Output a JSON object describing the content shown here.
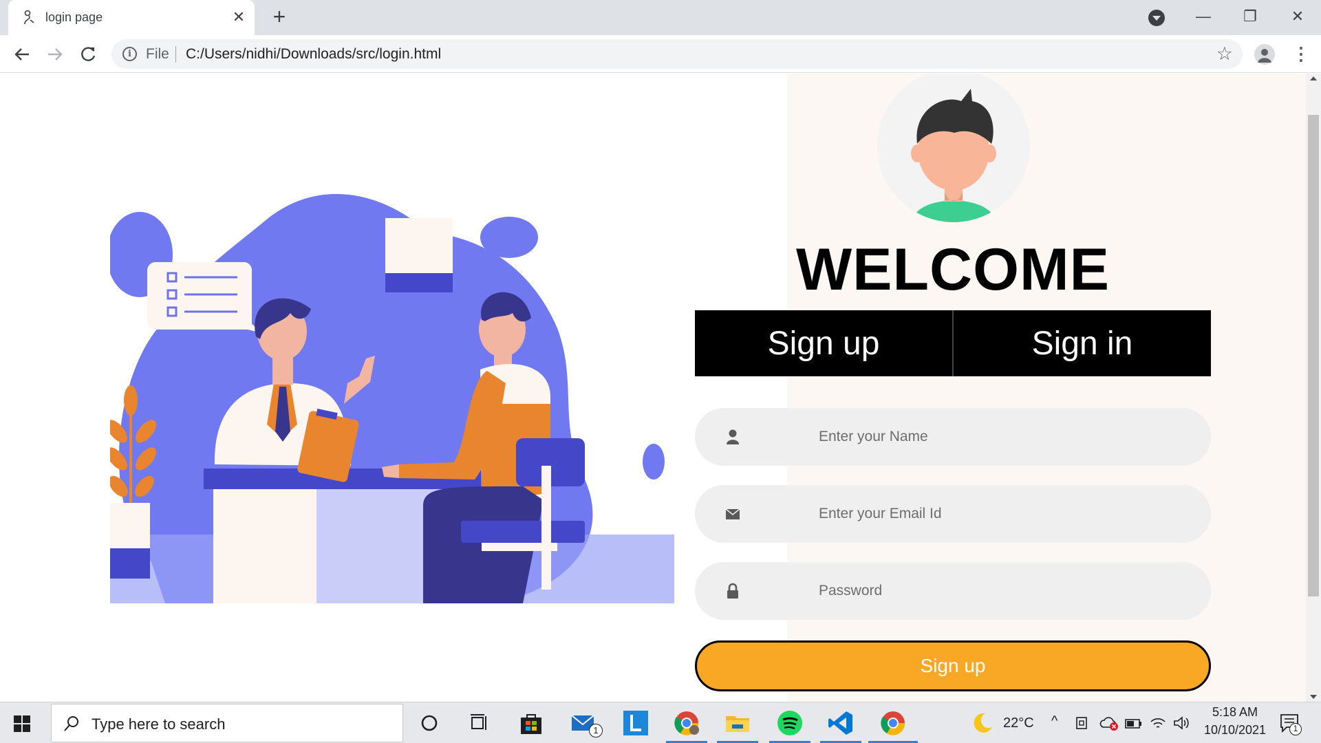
{
  "browser": {
    "tab_title": "login page",
    "tab_close": "✕",
    "new_tab": "+",
    "file_label": "File",
    "url": "C:/Users/nidhi/Downloads/src/login.html",
    "window_minimize": "—",
    "window_restore": "❐",
    "window_close": "✕"
  },
  "page": {
    "welcome": "WELCOME",
    "tabs": [
      "Sign up",
      "Sign in"
    ],
    "fields": [
      {
        "placeholder": "Enter your Name",
        "icon": "user-icon"
      },
      {
        "placeholder": "Enter your Email Id",
        "icon": "envelope-icon"
      },
      {
        "placeholder": "Password",
        "icon": "lock-icon"
      }
    ],
    "submit_label": "Sign up",
    "colors": {
      "accent": "#f9a825",
      "illustration_blue": "#7079f0",
      "illustration_orange": "#e9852e"
    }
  },
  "taskbar": {
    "search_placeholder": "Type here to search",
    "weather": "22°C",
    "time": "5:18 AM",
    "date": "10/10/2021",
    "mail_badge": "1",
    "notification_badge": "1"
  }
}
